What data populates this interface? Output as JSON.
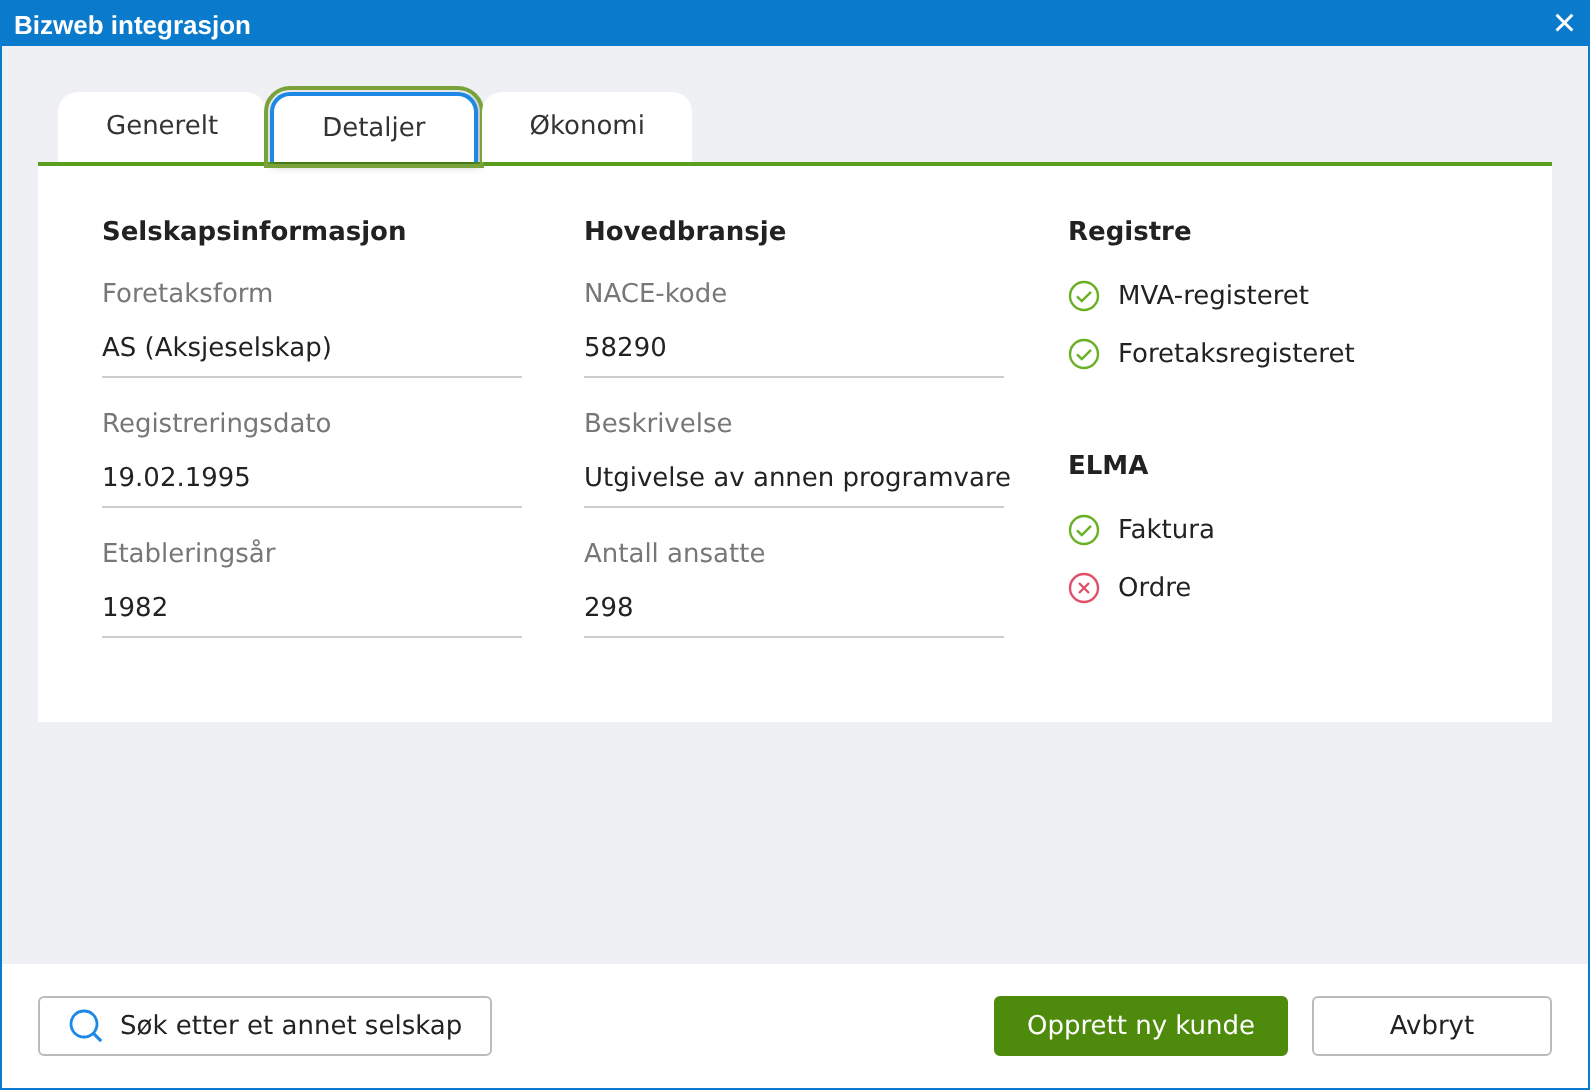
{
  "window": {
    "title": "Bizweb integrasjon",
    "close": "×"
  },
  "tabs": [
    {
      "label": "Generelt",
      "selected": false
    },
    {
      "label": "Detaljer",
      "selected": true
    },
    {
      "label": "Økonomi",
      "selected": false
    }
  ],
  "columns": [
    {
      "heading": "Selskapsinformasjon",
      "fields": [
        {
          "label": "Foretaksform",
          "value": "AS (Aksjeselskap)"
        },
        {
          "label": "Registreringsdato",
          "value": "19.02.1995"
        },
        {
          "label": "Etableringsår",
          "value": "1982"
        }
      ]
    },
    {
      "heading": "Hovedbransje",
      "fields": [
        {
          "label": "NACE-kode",
          "value": "58290"
        },
        {
          "label": "Beskrivelse",
          "value": "Utgivelse av annen programvare"
        },
        {
          "label": "Antall ansatte",
          "value": "298"
        }
      ]
    }
  ],
  "status_groups": [
    {
      "heading": "Registre",
      "items": [
        {
          "label": "MVA-registeret",
          "kind": "ok"
        },
        {
          "label": "Foretaksregisteret",
          "kind": "ok"
        }
      ]
    },
    {
      "heading": "ELMA",
      "items": [
        {
          "label": "Faktura",
          "kind": "ok"
        },
        {
          "label": "Ordre",
          "kind": "error"
        }
      ]
    }
  ],
  "footer": {
    "search_button": "Søk etter et annet selskap",
    "primary_button": "Opprett ny kunde",
    "cancel_button": "Avbryt"
  }
}
